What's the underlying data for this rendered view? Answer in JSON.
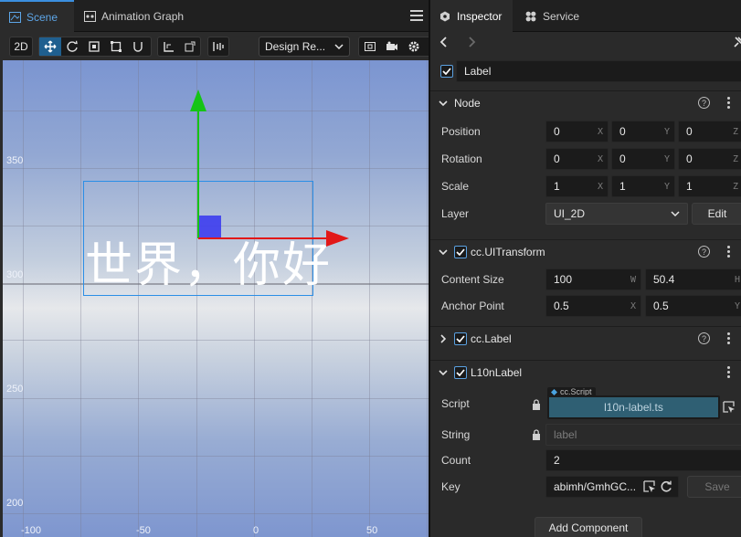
{
  "scene_panel": {
    "tabs": [
      {
        "label": "Scene",
        "icon": "scene-icon",
        "active": true
      },
      {
        "label": "Animation Graph",
        "icon": "animation-graph-icon",
        "active": false
      }
    ],
    "toolbar": {
      "mode_2d": "2D",
      "tools": [
        "move-tool-icon",
        "rotate-tool-icon",
        "scale-tool-icon",
        "rect-tool-icon",
        "transform-tool-icon"
      ],
      "design_resolution": "Design Re..."
    },
    "ruler_y": [
      "350",
      "300",
      "250",
      "200"
    ],
    "ruler_x": [
      "-100",
      "-50",
      "0",
      "50"
    ],
    "label_text": "世界，你好",
    "accent": "#2b8ee6"
  },
  "inspector": {
    "tabs": [
      {
        "label": "Inspector",
        "icon": "inspector-icon",
        "active": true
      },
      {
        "label": "Service",
        "icon": "service-icon",
        "active": false
      }
    ],
    "node_name": "Label",
    "node_section": {
      "title": "Node",
      "position": {
        "label": "Position",
        "x": "0",
        "y": "0",
        "z": "0"
      },
      "rotation": {
        "label": "Rotation",
        "x": "0",
        "y": "0",
        "z": "0"
      },
      "scale": {
        "label": "Scale",
        "x": "1",
        "y": "1",
        "z": "1"
      },
      "layer": {
        "label": "Layer",
        "value": "UI_2D",
        "edit": "Edit"
      }
    },
    "axis_letters": {
      "x": "X",
      "y": "Y",
      "z": "Z",
      "w": "W",
      "h": "H"
    },
    "ui_transform": {
      "title": "cc.UITransform",
      "content_size": {
        "label": "Content Size",
        "w": "100",
        "h": "50.4"
      },
      "anchor_point": {
        "label": "Anchor Point",
        "x": "0.5",
        "y": "0.5"
      }
    },
    "cc_label": {
      "title": "cc.Label"
    },
    "l10n_label": {
      "title": "L10nLabel",
      "script": {
        "label": "Script",
        "tag": "cc.Script",
        "value": "l10n-label.ts"
      },
      "string": {
        "label": "String",
        "placeholder": "label"
      },
      "count": {
        "label": "Count",
        "value": "2"
      },
      "key": {
        "label": "Key",
        "value": "abimh/GmhGC...",
        "save": "Save"
      }
    },
    "add_component": "Add Component"
  }
}
